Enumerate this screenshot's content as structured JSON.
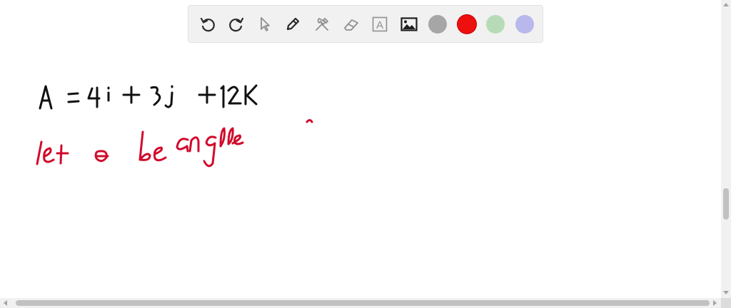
{
  "toolbar": {
    "tools": [
      {
        "name": "undo-icon"
      },
      {
        "name": "redo-icon"
      },
      {
        "name": "pointer-icon"
      },
      {
        "name": "pen-icon"
      },
      {
        "name": "tools-icon"
      },
      {
        "name": "eraser-icon"
      },
      {
        "name": "text-icon",
        "glyph": "A"
      },
      {
        "name": "image-icon"
      }
    ],
    "colors": [
      "#a6a6a6",
      "#ee0f0f",
      "#b7dbb6",
      "#b8b8ec"
    ],
    "selected_color": "#ee0f0f"
  },
  "canvas": {
    "ink_colors": {
      "black": "#111111",
      "red": "#d10a2b"
    }
  }
}
